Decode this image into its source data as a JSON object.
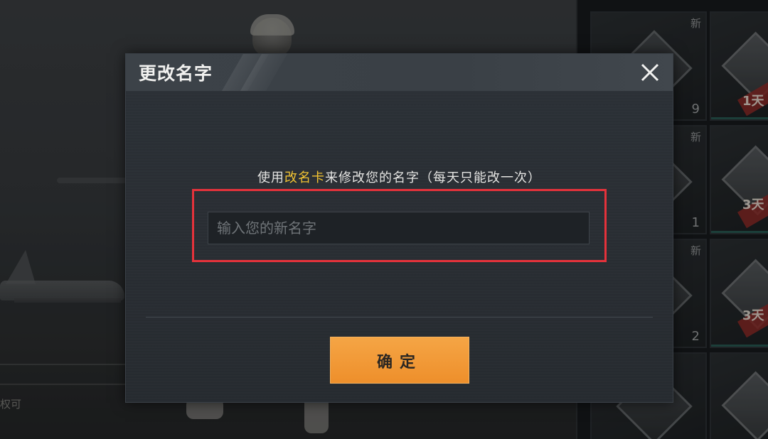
{
  "background": {
    "left_text": "权可"
  },
  "inventory": {
    "slots": [
      {
        "new_label": "新",
        "count": "9",
        "badge": ""
      },
      {
        "new_label": "",
        "count": "",
        "badge": "1天"
      },
      {
        "new_label": "新",
        "count": "1",
        "badge": ""
      },
      {
        "new_label": "",
        "count": "",
        "badge": "3天"
      },
      {
        "new_label": "新",
        "count": "2",
        "badge": ""
      },
      {
        "new_label": "",
        "count": "",
        "badge": "3天"
      }
    ]
  },
  "dialog": {
    "title": "更改名字",
    "close_icon": "close-icon",
    "instruction_prefix": "使用",
    "instruction_highlight": "改名卡",
    "instruction_suffix": "来修改您的名字（每天只能改一次）",
    "input_placeholder": "输入您的新名字",
    "input_value": "",
    "confirm_label": "确定"
  },
  "colors": {
    "highlight": "#f0c233",
    "confirm_button": "#f29a38",
    "annotation_box": "#e5323b"
  }
}
